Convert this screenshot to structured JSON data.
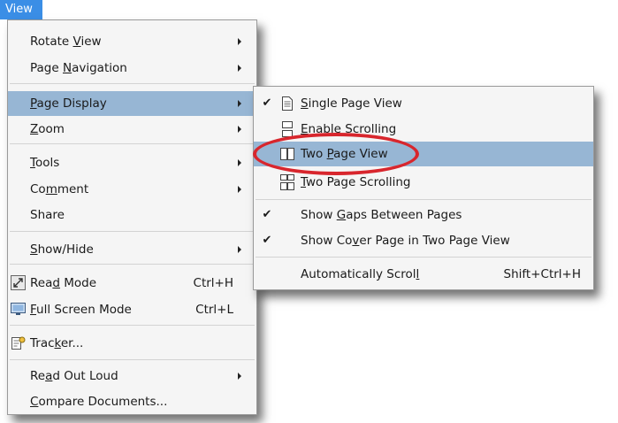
{
  "menubar": {
    "view_label": "View"
  },
  "main_menu": {
    "rotate_view": "Rotate View",
    "page_navigation": "Page Navigation",
    "page_display": "Page Display",
    "zoom": "Zoom",
    "tools": "Tools",
    "comment": "Comment",
    "share": "Share",
    "show_hide": "Show/Hide",
    "read_mode": "Read Mode",
    "read_mode_shortcut": "Ctrl+H",
    "full_screen_mode": "Full Screen Mode",
    "full_screen_shortcut": "Ctrl+L",
    "tracker": "Tracker...",
    "read_out_loud": "Read Out Loud",
    "compare_documents": "Compare Documents..."
  },
  "page_display_submenu": {
    "single_page_view": "Single Page View",
    "enable_scrolling": "Enable Scrolling",
    "two_page_view": "Two Page View",
    "two_page_scrolling": "Two Page Scrolling",
    "show_gaps": "Show Gaps Between Pages",
    "show_cover_page": "Show Cover Page in Two Page View",
    "automatically_scroll": "Automatically Scroll",
    "automatically_scroll_shortcut": "Shift+Ctrl+H",
    "check_mark": "✔"
  },
  "colors": {
    "menubar_highlight": "#3b8ee6",
    "menu_hover": "#97b6d4",
    "annotation_circle": "#d8262d"
  }
}
